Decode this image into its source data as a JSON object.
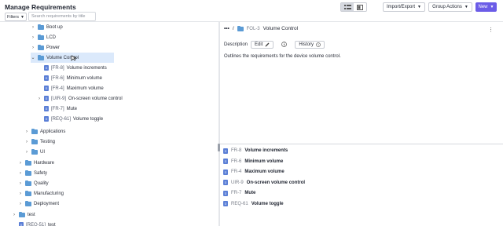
{
  "header": {
    "title": "Manage Requirements",
    "import_export": "Import/Export",
    "group_actions": "Group Actions",
    "new": "New"
  },
  "toolbar": {
    "filters": "Filters",
    "search_placeholder": "Search requirements by title"
  },
  "tree": {
    "rows": [
      {
        "label": "Boot up"
      },
      {
        "label": "LCD"
      },
      {
        "label": "Power"
      },
      {
        "label": "Volume Control"
      },
      {
        "id": "[FR-8]",
        "label": "Volume increments"
      },
      {
        "id": "[FR-6]",
        "label": "Minimum volume"
      },
      {
        "id": "[FR-4]",
        "label": "Maximum volume"
      },
      {
        "id": "[UIR-9]",
        "label": "On-screen volume control"
      },
      {
        "id": "[FR-7]",
        "label": "Mute"
      },
      {
        "id": "[REQ-61]",
        "label": "Volume toggle"
      },
      {
        "label": "Applications"
      },
      {
        "label": "Testing"
      },
      {
        "label": "UI"
      },
      {
        "label": "Hardware"
      },
      {
        "label": "Safety"
      },
      {
        "label": "Quality"
      },
      {
        "label": "Manufacturing"
      },
      {
        "label": "Deployment"
      },
      {
        "label": "test"
      },
      {
        "id": "[REQ-51]",
        "label": "test"
      }
    ]
  },
  "detail": {
    "crumb_dots": "•••",
    "crumb_sep": "/",
    "folder_id": "FOL-3",
    "folder_name": "Volume Control",
    "tab_description": "Description",
    "tab_edit": "Edit",
    "tab_history": "History",
    "description": "Outlines the requirements for the device volume control.",
    "requirements": [
      {
        "id": "FR-8",
        "title": "Volume increments"
      },
      {
        "id": "FR-6",
        "title": "Minimum volume"
      },
      {
        "id": "FR-4",
        "title": "Maximum volume"
      },
      {
        "id": "UIR-9",
        "title": "On-screen volume control"
      },
      {
        "id": "FR-7",
        "title": "Mute"
      },
      {
        "id": "REQ-61",
        "title": "Volume toggle"
      }
    ]
  },
  "colors": {
    "accent": "#6b5ce7",
    "folder": "#5b9bd5",
    "requirement": "#5b7fd6",
    "selected": "#dbe9fb"
  }
}
